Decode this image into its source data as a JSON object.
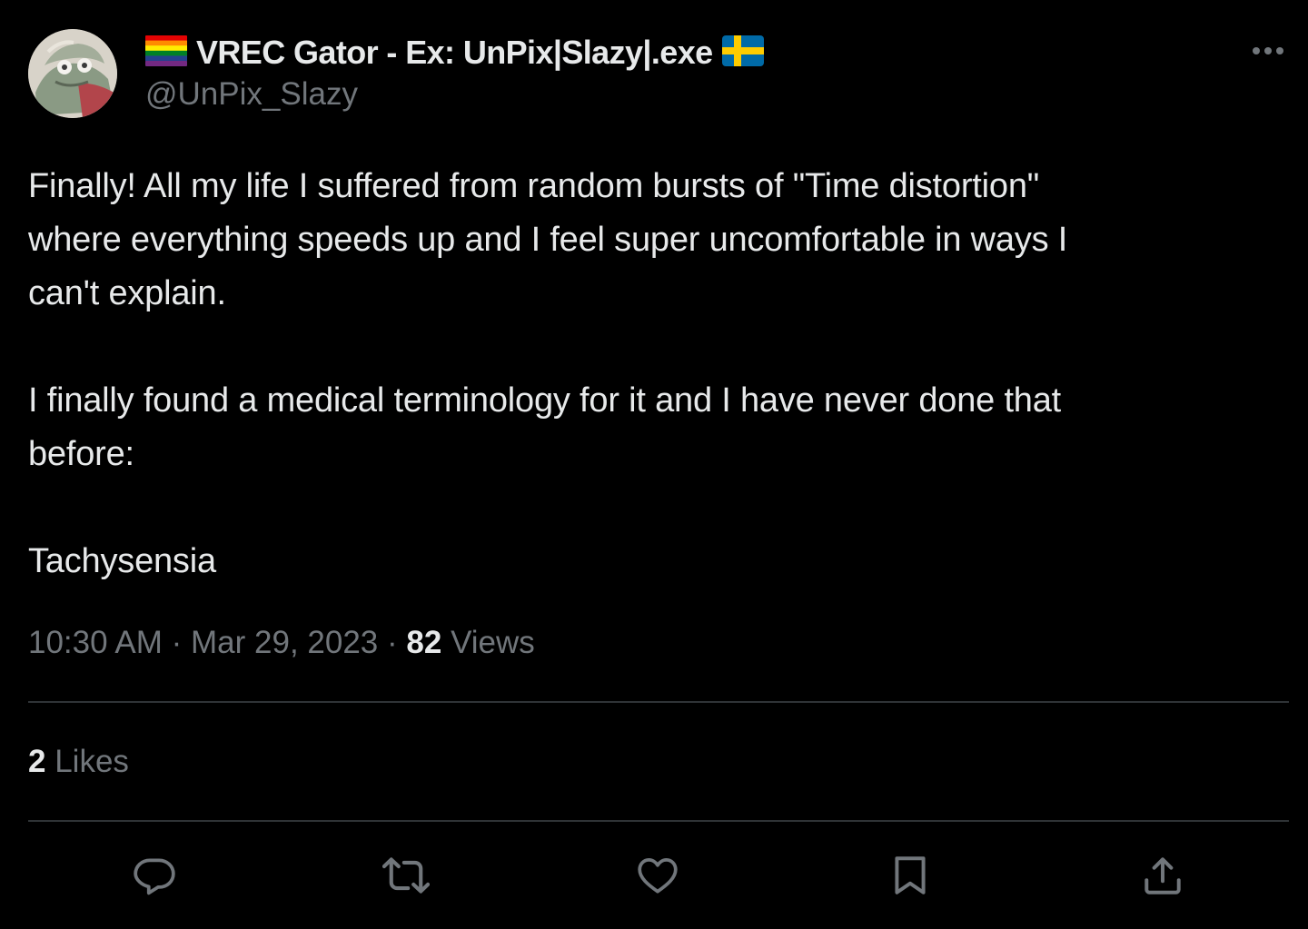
{
  "author": {
    "display_name": "VREC Gator - Ex: UnPix|Slazy|.exe",
    "handle": "@UnPix_Slazy",
    "name_prefix_icon": "rainbow-flag-icon",
    "name_suffix_icon": "sweden-flag-icon",
    "avatar_icon": "gator-avatar"
  },
  "tweet": {
    "paragraphs": [
      [
        "Finally! All my life I suffered from random bursts of \"Time distortion\"",
        "where everything speeds up and I feel super uncomfortable in ways I",
        "can't explain."
      ],
      [
        "I finally found a medical terminology for it and I have never done that",
        "before:"
      ],
      [
        "Tachysensia"
      ]
    ]
  },
  "meta": {
    "time": "10:30 AM",
    "separator": "·",
    "date": "Mar 29, 2023",
    "views_count": "82",
    "views_label": "Views"
  },
  "stats": {
    "likes_count": "2",
    "likes_label": "Likes"
  },
  "actions": {
    "icons": [
      "reply-icon",
      "retweet-icon",
      "like-icon",
      "bookmark-icon",
      "share-icon"
    ]
  },
  "more_icon": "more-options-icon",
  "colors": {
    "background": "#000000",
    "primary_text": "#e7e9ea",
    "secondary_text": "#71767b",
    "divider": "#2f3336"
  }
}
